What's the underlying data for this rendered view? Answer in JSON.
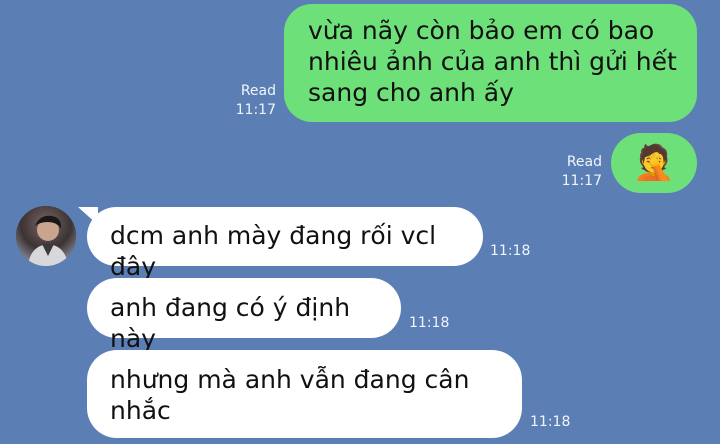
{
  "messages": {
    "out1": {
      "text": "vừa nãy còn bảo em có bao\nnhiêu ảnh của anh thì gửi hết\nsang cho anh ấy",
      "status": "Read",
      "time": "11:17"
    },
    "out2": {
      "emoji": "🤦",
      "emoji_name": "face-palm-icon",
      "status": "Read",
      "time": "11:17"
    },
    "in1": {
      "text": "dcm anh mày đang rối vcl đây",
      "time": "11:18"
    },
    "in2": {
      "text": "anh đang có ý định này",
      "time": "11:18"
    },
    "in3": {
      "text": "nhưng mà anh vẫn đang cân\nnhắc",
      "time": "11:18"
    }
  },
  "colors": {
    "background": "#5b7fb5",
    "outgoing_bubble": "#6ee07a",
    "incoming_bubble": "#ffffff"
  },
  "avatar": {
    "icon": "user-avatar-icon"
  }
}
